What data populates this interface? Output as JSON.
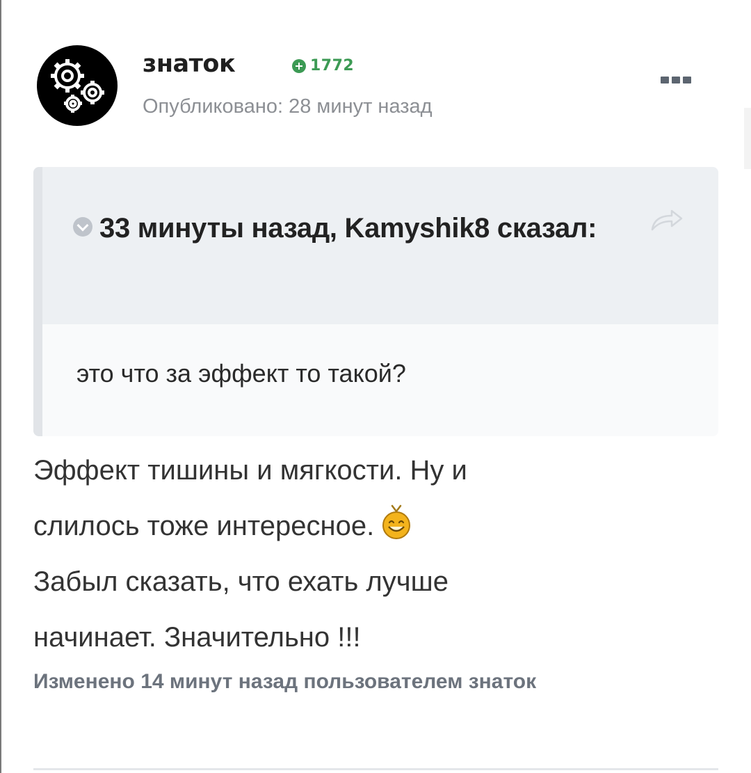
{
  "post": {
    "author": "знаток",
    "reputation": "1772",
    "published": "Опубликовано: 28 минут назад",
    "menu_icon": "more-dots-icon",
    "quote": {
      "title": "33 минуты назад, Kamyshik8 сказал:",
      "text": "это что за эффект то такой?",
      "icon": "chevron-down-icon",
      "share_icon": "share-icon"
    },
    "body_lines": [
      "Эффект тишины и мягкости. Ну и",
      "слилось тоже интересное.",
      "Забыл сказать, что ехать лучше",
      "начинает. Значительно !!!"
    ],
    "edited": "Изменено 14 минут назад пользователем знаток"
  },
  "colors": {
    "reputation": "#3c9a54",
    "muted_text": "#8c8f94",
    "quote_header_bg": "#edf0f3",
    "quote_body_bg": "#f9fafb"
  }
}
